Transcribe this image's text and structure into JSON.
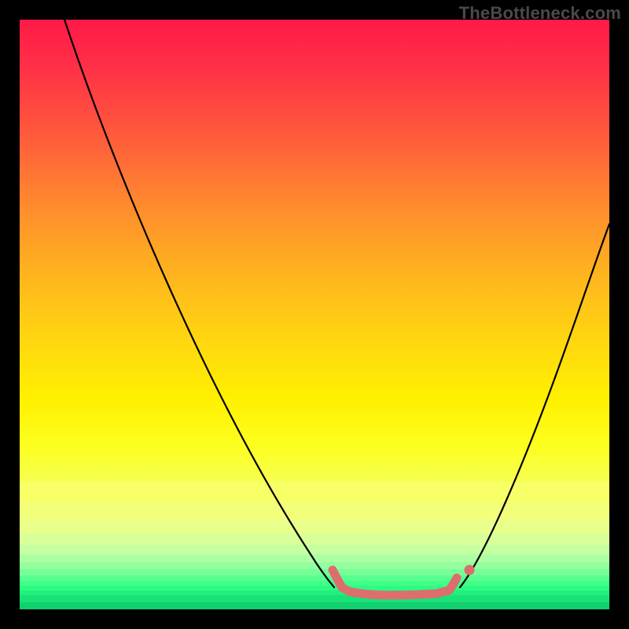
{
  "watermark": "TheBottleneck.com",
  "chart_data": {
    "type": "line",
    "title": "",
    "xlabel": "",
    "ylabel": "",
    "ylim": [
      0,
      100
    ],
    "xlim": [
      0,
      100
    ],
    "background": {
      "gradient_top_color": "#ff1a47",
      "gradient_mid_color": "#ffd80f",
      "gradient_bottom_color": "#11d06e",
      "description": "vertical red-to-yellow gradient with discrete yellow-green-to-green bands near the bottom"
    },
    "series": [
      {
        "name": "left-curve",
        "color": "#000000",
        "x": [
          7,
          15,
          25,
          35,
          45,
          53
        ],
        "y": [
          100,
          78,
          55,
          33,
          12,
          3
        ]
      },
      {
        "name": "flat-bottom",
        "color": "#de6d6d",
        "x": [
          53,
          56,
          60,
          65,
          70,
          73,
          74
        ],
        "y": [
          6,
          3,
          2,
          2,
          2,
          3,
          5
        ]
      },
      {
        "name": "right-curve",
        "color": "#000000",
        "x": [
          75,
          80,
          86,
          92,
          100
        ],
        "y": [
          3,
          12,
          28,
          46,
          65
        ]
      }
    ],
    "markers": [
      {
        "name": "marker-dot",
        "color": "#de6d6d",
        "x": 76,
        "y": 6
      }
    ],
    "annotations": []
  }
}
